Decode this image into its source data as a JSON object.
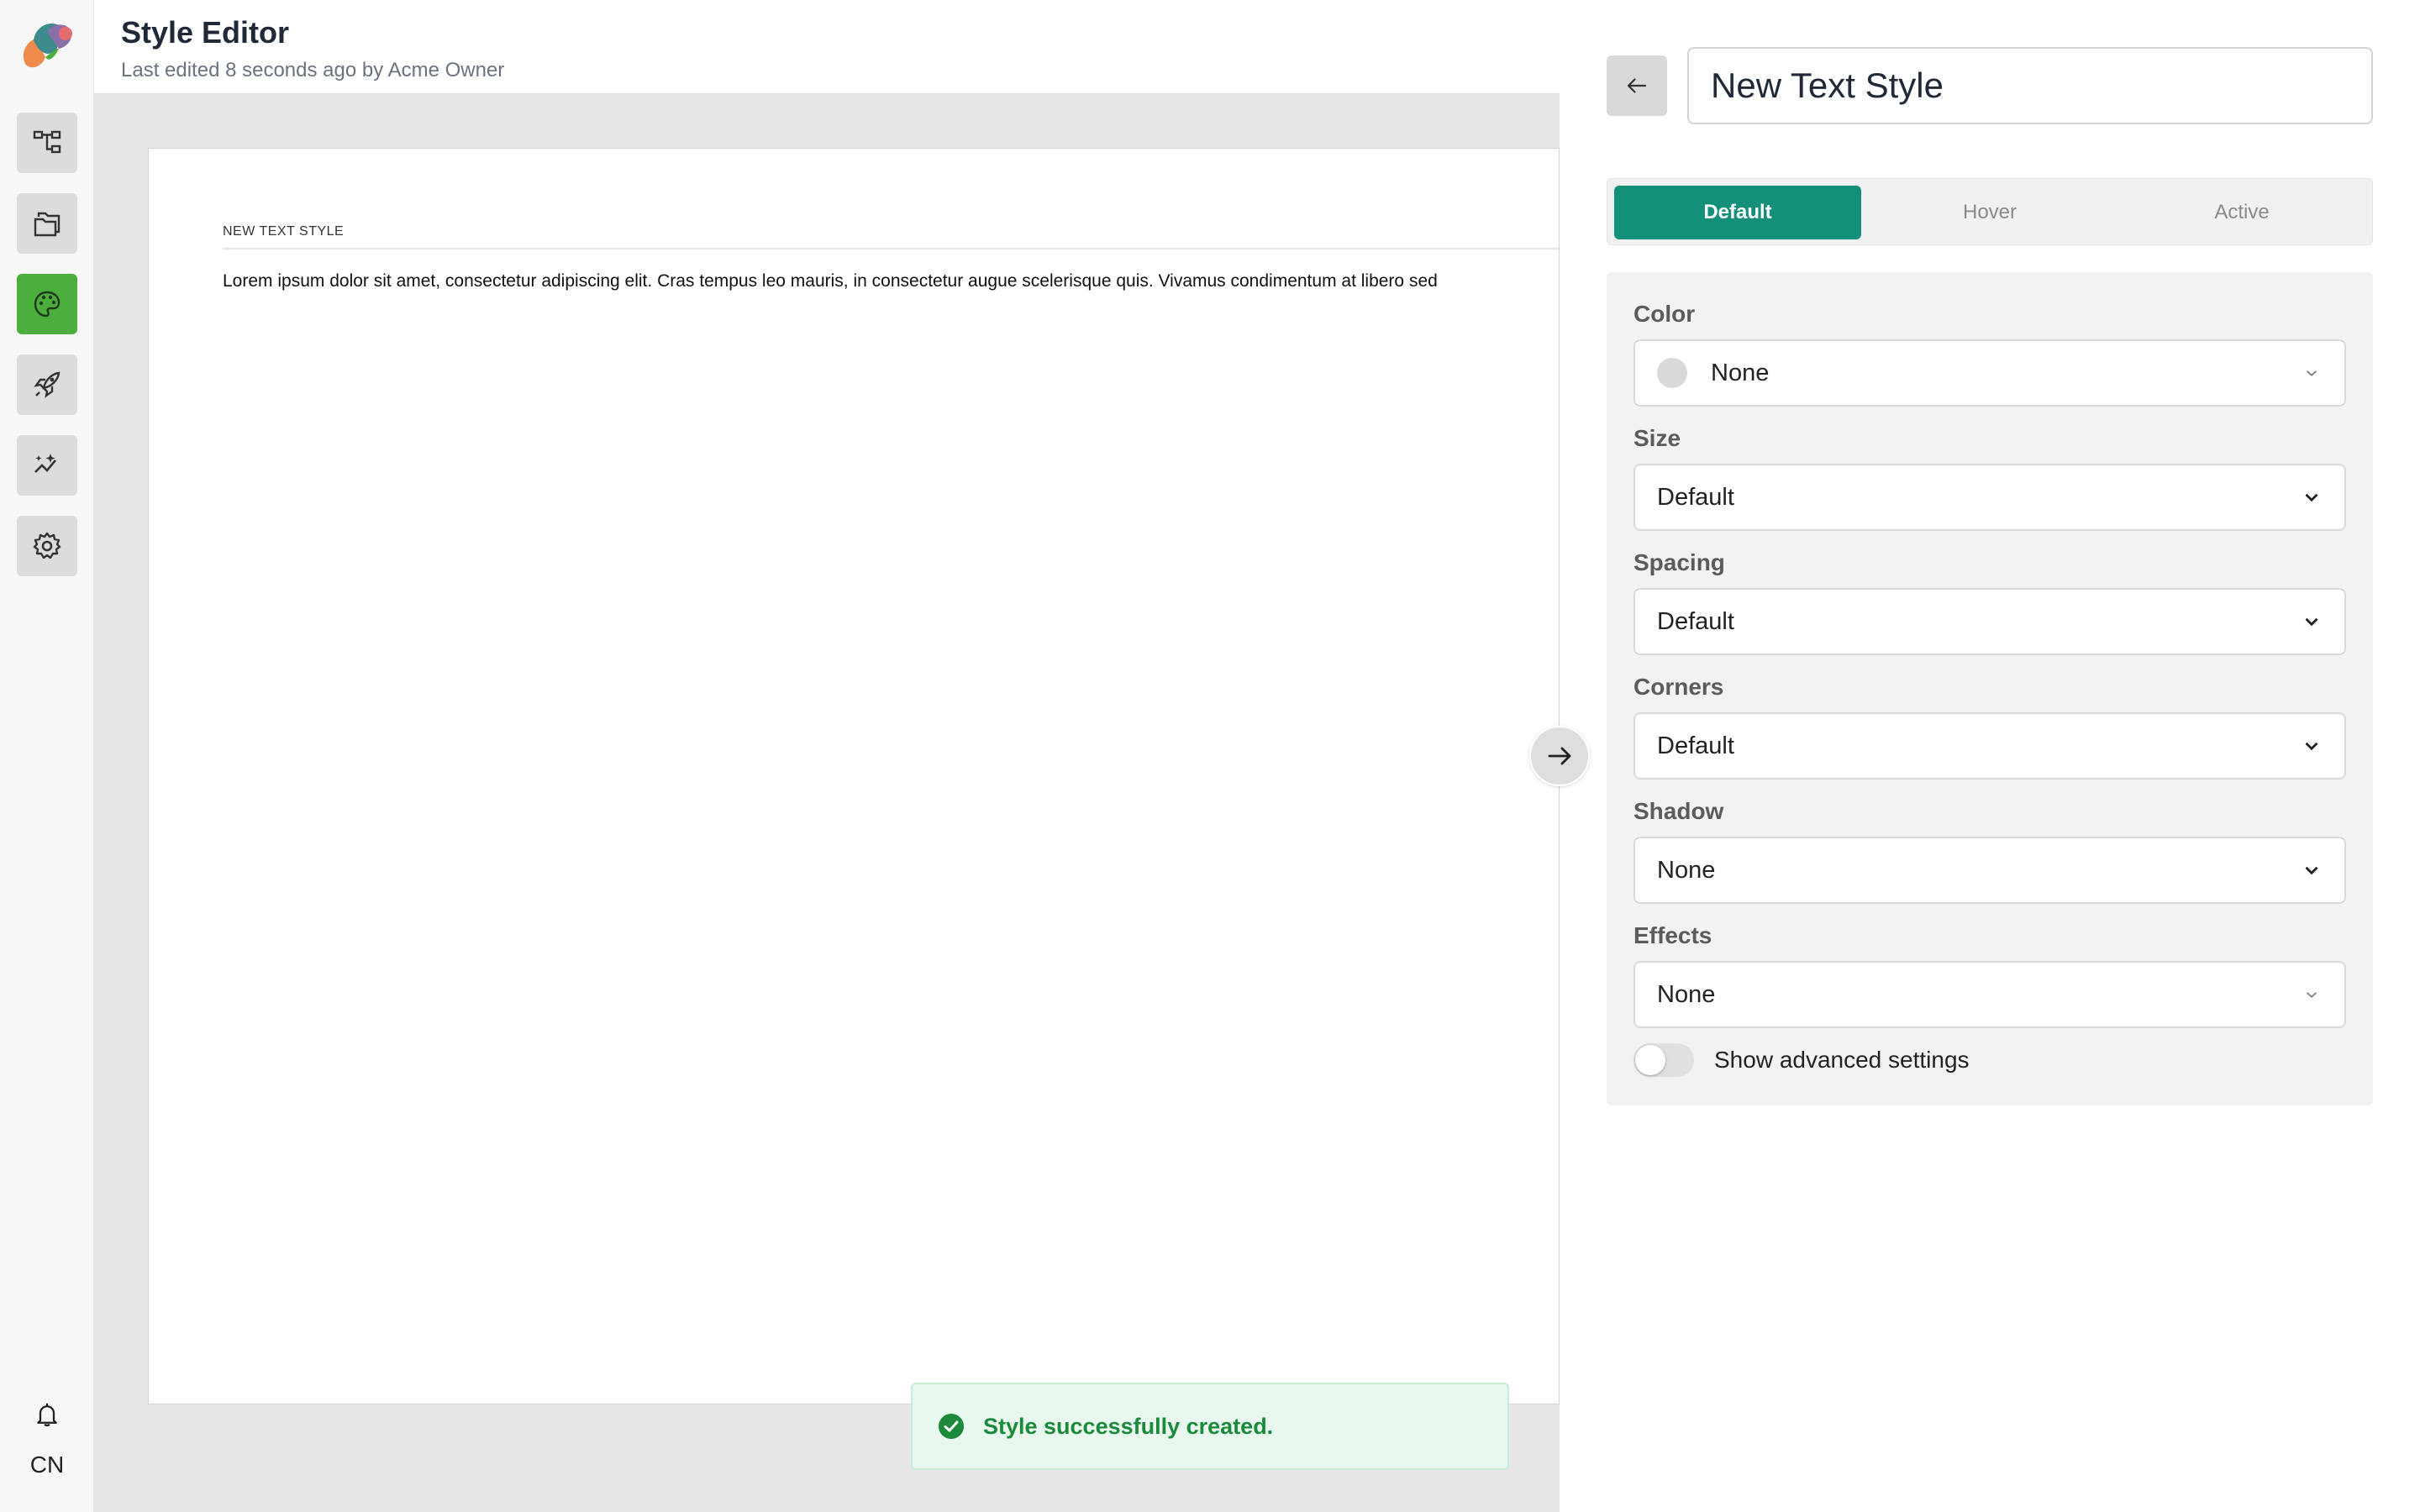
{
  "header": {
    "title": "Style Editor",
    "subtitle": "Last edited 8 seconds ago by Acme Owner"
  },
  "sidebar": {
    "items": [
      {
        "icon": "sitemap-icon"
      },
      {
        "icon": "folders-icon"
      },
      {
        "icon": "palette-icon",
        "active": true
      },
      {
        "icon": "rocket-icon"
      },
      {
        "icon": "analytics-icon"
      },
      {
        "icon": "gear-icon"
      }
    ],
    "user_initials": "CN"
  },
  "canvas": {
    "label": "NEW TEXT STYLE",
    "sample_text": "Lorem ipsum dolor sit amet, consectetur adipiscing elit. Cras tempus leo mauris, in consectetur augue scelerisque quis. Vivamus condimentum at libero sed"
  },
  "panel": {
    "style_name": "New Text Style",
    "tabs": [
      {
        "label": "Default",
        "active": true
      },
      {
        "label": "Hover",
        "active": false
      },
      {
        "label": "Active",
        "active": false
      }
    ],
    "fields": {
      "color": {
        "label": "Color",
        "value": "None"
      },
      "size": {
        "label": "Size",
        "value": "Default"
      },
      "spacing": {
        "label": "Spacing",
        "value": "Default"
      },
      "corners": {
        "label": "Corners",
        "value": "Default"
      },
      "shadow": {
        "label": "Shadow",
        "value": "None"
      },
      "effects": {
        "label": "Effects",
        "value": "None"
      }
    },
    "advanced_toggle": {
      "label": "Show advanced settings",
      "on": false
    }
  },
  "toast": {
    "message": "Style successfully created."
  },
  "colors": {
    "accent": "#13907a",
    "active_nav": "#4caf3d",
    "toast_bg": "#e9f8ef",
    "toast_text": "#1b8a3a"
  }
}
